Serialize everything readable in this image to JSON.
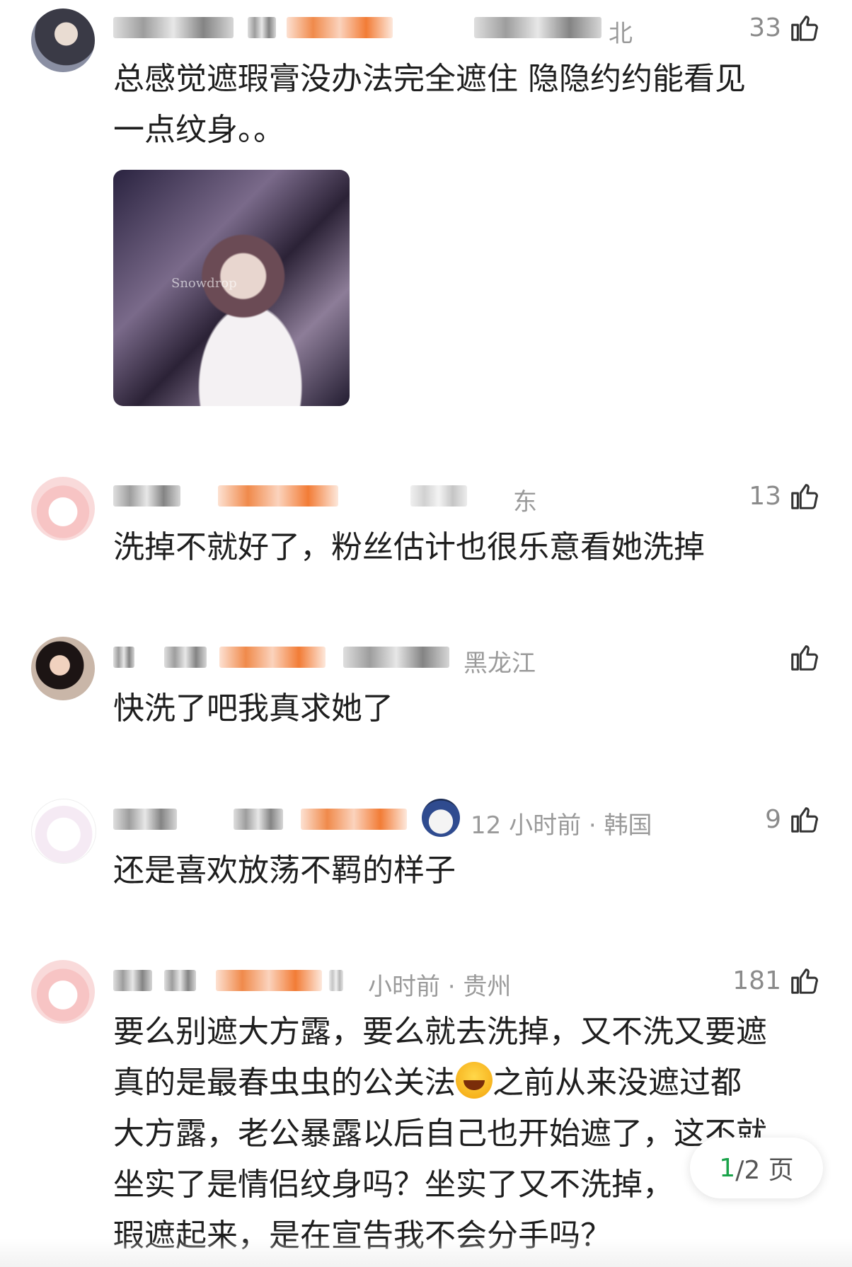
{
  "comments": [
    {
      "meta_suffix": "北",
      "likes": "33",
      "text_lines": [
        "总感觉遮瑕膏没办法完全遮住 隐隐约约能看见",
        "一点纹身。。"
      ],
      "photo_text": "Snowdrop"
    },
    {
      "meta_suffix": "东",
      "likes": "13",
      "text_lines": [
        "洗掉不就好了，粉丝估计也很乐意看她洗掉"
      ]
    },
    {
      "meta_suffix": "黑龙江",
      "likes": "",
      "text_lines": [
        "快洗了吧我真求她了"
      ]
    },
    {
      "meta_suffix": "12 小时前 · 韩国",
      "likes": "9",
      "text_lines": [
        "还是喜欢放荡不羁的样子"
      ]
    },
    {
      "meta_suffix": "小时前 · 贵州",
      "likes": "181",
      "text_lines": [
        "要么别遮大方露，要么就去洗掉，又不洗又要遮",
        "真的是最春虫虫的公关法",
        "之前从来没遮过都",
        "大方露，老公暴露以后自己也开始遮了，这不就",
        "坐实了是情侣纹身吗？坐实了又不洗掉，",
        "瑕遮起来，是在宣告我不会分手吗？"
      ]
    }
  ],
  "pager": {
    "current": "1",
    "total": "/2 页"
  },
  "icons": {
    "like": "thumbs-up-icon",
    "emoji": "laughing-crying-emoji-icon"
  },
  "colors": {
    "pager_current": "#1aa34a",
    "meta_gray": "#9a9a9a"
  }
}
